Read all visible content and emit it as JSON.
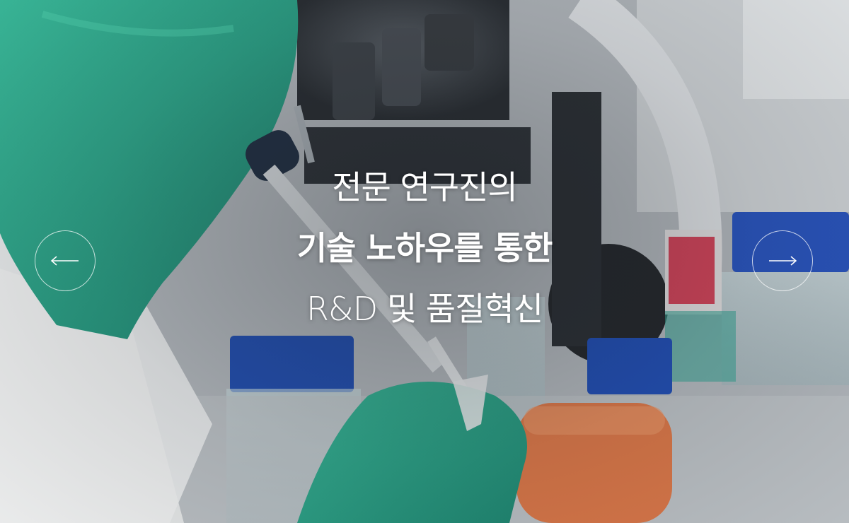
{
  "hero": {
    "headline_line1": "전문 연구진의",
    "headline_line2": "기술 노하우를 통한",
    "headline_line3": "R&D 및 품질혁신"
  },
  "controls": {
    "prev_icon": "arrow-left-icon",
    "next_icon": "arrow-right-icon"
  },
  "colors": {
    "text": "#ffffff",
    "glove": "#2fa88f",
    "cap_blue": "#1f4fb0",
    "cap_orange": "#e07a4a"
  }
}
